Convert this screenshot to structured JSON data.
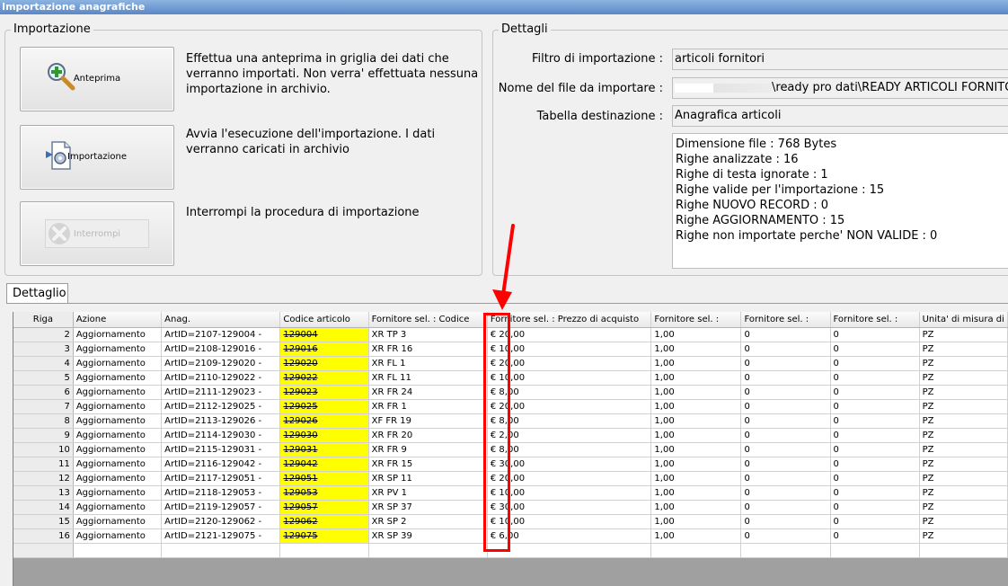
{
  "window": {
    "title": "Importazione anagrafiche"
  },
  "importazione": {
    "legend": "Importazione",
    "preview_button": "Anteprima",
    "preview_desc": "Effettua una anteprima in griglia dei dati che verranno importati. Non verra' effettuata nessuna importazione in archivio.",
    "import_button": "Importazione",
    "import_desc": "Avvia l'esecuzione dell'importazione. I dati verranno caricati in archivio",
    "stop_button": "Interrompi",
    "stop_desc": "Interrompi la procedura di importazione"
  },
  "dettagli": {
    "legend": "Dettagli",
    "filter_label": "Filtro di importazione :",
    "filter_value": "articoli fornitori",
    "file_label": "Nome del file da importare :",
    "file_value": "\\ready pro dati\\READY ARTICOLI FORNITORI",
    "table_label": "Tabella destinazione :",
    "table_value": "Anagrafica articoli",
    "info_lines": [
      "Dimensione file : 768 Bytes",
      "Righe analizzate : 16",
      "Righe di testa ignorate : 1",
      "Righe valide per l'importazione : 15",
      "Righe NUOVO RECORD : 0",
      "Righe AGGIORNAMENTO  : 15",
      "Righe non importate perche' NON VALIDE : 0"
    ]
  },
  "dettaglio_tab": {
    "label": "Dettaglio"
  },
  "grid": {
    "columns": [
      "Riga",
      "Azione",
      "Anag.",
      "Codice articolo",
      "Fornitore sel. : Codice",
      "Fornitore sel. : Prezzo di acquisto",
      "Fornitore sel. :",
      "Fornitore sel. :",
      "Fornitore sel. :",
      "Unita' di misura di"
    ],
    "rows": [
      [
        "2",
        "Aggiornamento",
        "ArtID=2107-129004 -",
        "129004",
        "XR TP 3",
        "€ 20,00",
        "1,00",
        "0",
        "0",
        "PZ"
      ],
      [
        "3",
        "Aggiornamento",
        "ArtID=2108-129016 -",
        "129016",
        "XR FR 16",
        "€ 10,00",
        "1,00",
        "0",
        "0",
        "PZ"
      ],
      [
        "4",
        "Aggiornamento",
        "ArtID=2109-129020 -",
        "129020",
        "XR FL 1",
        "€ 20,00",
        "1,00",
        "0",
        "0",
        "PZ"
      ],
      [
        "5",
        "Aggiornamento",
        "ArtID=2110-129022 -",
        "129022",
        "XR FL 11",
        "€ 10,00",
        "1,00",
        "0",
        "0",
        "PZ"
      ],
      [
        "6",
        "Aggiornamento",
        "ArtID=2111-129023 -",
        "129023",
        "XR FR 24",
        "€ 8,00",
        "1,00",
        "0",
        "0",
        "PZ"
      ],
      [
        "7",
        "Aggiornamento",
        "ArtID=2112-129025 -",
        "129025",
        "XR FR 1",
        "€ 20,00",
        "1,00",
        "0",
        "0",
        "PZ"
      ],
      [
        "8",
        "Aggiornamento",
        "ArtID=2113-129026 -",
        "129026",
        "XF FR 19",
        "€ 8,00",
        "1,00",
        "0",
        "0",
        "PZ"
      ],
      [
        "9",
        "Aggiornamento",
        "ArtID=2114-129030 -",
        "129030",
        "XR FR 20",
        "€ 2,00",
        "1,00",
        "0",
        "0",
        "PZ"
      ],
      [
        "10",
        "Aggiornamento",
        "ArtID=2115-129031 -",
        "129031",
        "XR FR 9",
        "€ 8,00",
        "1,00",
        "0",
        "0",
        "PZ"
      ],
      [
        "11",
        "Aggiornamento",
        "ArtID=2116-129042 -",
        "129042",
        "XR FR 15",
        "€ 30,00",
        "1,00",
        "0",
        "0",
        "PZ"
      ],
      [
        "12",
        "Aggiornamento",
        "ArtID=2117-129051 -",
        "129051",
        "XR SP 11",
        "€ 20,00",
        "1,00",
        "0",
        "0",
        "PZ"
      ],
      [
        "13",
        "Aggiornamento",
        "ArtID=2118-129053 -",
        "129053",
        "XR PV 1",
        "€ 10,00",
        "1,00",
        "0",
        "0",
        "PZ"
      ],
      [
        "14",
        "Aggiornamento",
        "ArtID=2119-129057 -",
        "129057",
        "XR SP 37",
        "€ 30,00",
        "1,00",
        "0",
        "0",
        "PZ"
      ],
      [
        "15",
        "Aggiornamento",
        "ArtID=2120-129062 -",
        "129062",
        "XR SP 2",
        "€ 10,00",
        "1,00",
        "0",
        "0",
        "PZ"
      ],
      [
        "16",
        "Aggiornamento",
        "ArtID=2121-129075 -",
        "129075",
        "XR SP 39",
        "€ 6,00",
        "1,00",
        "0",
        "0",
        "PZ"
      ]
    ]
  },
  "colors": {
    "highlight": "#ffff00",
    "annotation": "#ff0000",
    "titlebar": "#6f9ad2"
  }
}
